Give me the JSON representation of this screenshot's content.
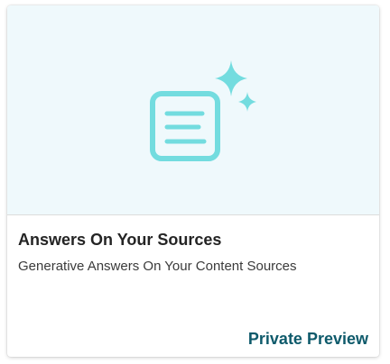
{
  "card": {
    "title": "Answers On Your Sources",
    "subtitle": "Generative Answers On Your Content Sources",
    "status": "Private Preview",
    "icon": "document-sparkle-icon"
  },
  "colors": {
    "hero_background": "#eff9fc",
    "icon": "#73dcdf",
    "status_text": "#0e5a6b"
  }
}
